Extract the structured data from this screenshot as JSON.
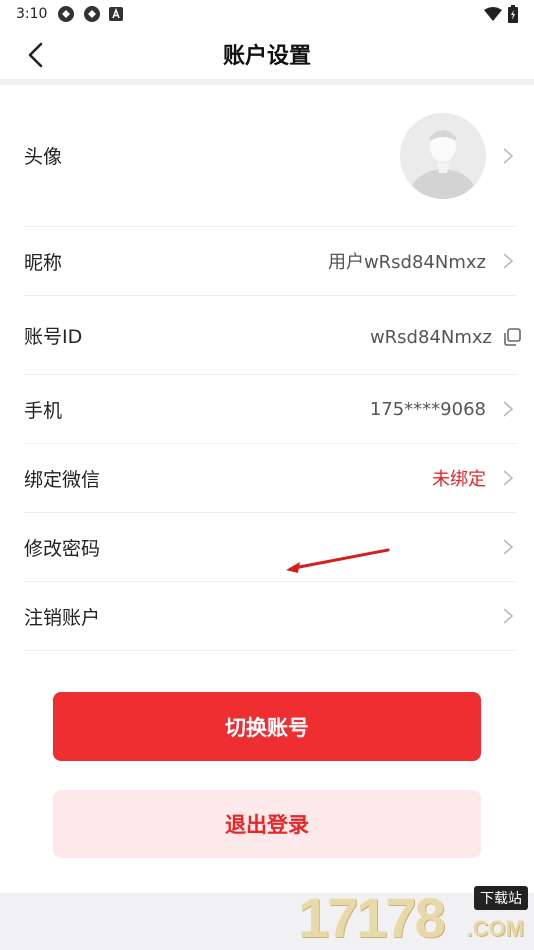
{
  "status_bar": {
    "time": "3:10",
    "left_icons": [
      "sync-icon",
      "sync-icon",
      "font-a-icon"
    ],
    "right_icons": [
      "wifi-icon",
      "battery-icon"
    ]
  },
  "nav": {
    "title": "账户设置",
    "back_icon": "chevron-left-icon"
  },
  "rows": {
    "avatar": {
      "label": "头像"
    },
    "nickname": {
      "label": "昵称",
      "value": "用户wRsd84Nmxz"
    },
    "account_id": {
      "label": "账号ID",
      "value": "wRsd84Nmxz",
      "icon": "copy-icon"
    },
    "phone": {
      "label": "手机",
      "value": "175****9068"
    },
    "wechat": {
      "label": "绑定微信",
      "value": "未绑定"
    },
    "password": {
      "label": "修改密码"
    },
    "cancel_account": {
      "label": "注销账户"
    }
  },
  "buttons": {
    "switch_account": "切换账号",
    "logout": "退出登录"
  },
  "watermark": {
    "digits": "17178",
    "badge": "下载站",
    "suffix": ".COM"
  },
  "colors": {
    "accent_red": "#ee2e31",
    "value_red": "#e8262a",
    "logout_bg": "#fde9e9",
    "divider_bg": "#f1f1f3"
  }
}
